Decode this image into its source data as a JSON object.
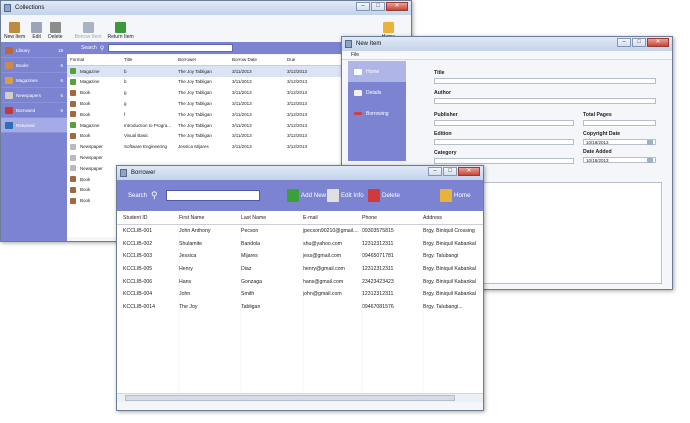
{
  "collections": {
    "title": "Collections",
    "toolbar": [
      {
        "label": "New Item",
        "icon": "new-item-icon",
        "color": "#c08a3e"
      },
      {
        "label": "Edit",
        "icon": "edit-icon",
        "color": "#9aa5b8"
      },
      {
        "label": "Delete",
        "icon": "delete-icon",
        "color": "#8c8c8c"
      },
      {
        "label": "Borrow Item",
        "icon": "borrow-icon",
        "color": "#a9b3c2"
      },
      {
        "label": "Return Item",
        "icon": "return-icon",
        "color": "#3a9a3a"
      }
    ],
    "home_label": "Home",
    "sidebar": [
      {
        "label": "Library",
        "count": "18",
        "color": "#b86b3a"
      },
      {
        "label": "Books",
        "count": "6",
        "color": "#c98b4a"
      },
      {
        "label": "Magazines",
        "count": "6",
        "color": "#d4a040"
      },
      {
        "label": "Newspapers",
        "count": "6",
        "color": "#cfcfcf"
      },
      {
        "label": "Borrowed",
        "count": "6",
        "color": "#c03a3a"
      },
      {
        "label": "Returned",
        "count": "",
        "color": "#2d6fb5"
      }
    ],
    "search_label": "Search",
    "columns": [
      "Format",
      "Title",
      "Borrower",
      "Borrow Date",
      "Due"
    ],
    "rows": [
      {
        "format": "Magazine",
        "title": "b",
        "borrower": "The Joy Tabligan",
        "borrow_date": "3/11/2013",
        "due": "3/12/2013",
        "icon": "#5aa03a"
      },
      {
        "format": "Magazine",
        "title": "b",
        "borrower": "The Joy Tabligan",
        "borrow_date": "3/11/2013",
        "due": "3/12/2013",
        "icon": "#5aa03a"
      },
      {
        "format": "Book",
        "title": "g",
        "borrower": "The Joy Tabligan",
        "borrow_date": "3/11/2013",
        "due": "3/12/2013",
        "icon": "#a5683a"
      },
      {
        "format": "Book",
        "title": "g",
        "borrower": "The Joy Tabligan",
        "borrow_date": "3/11/2013",
        "due": "3/12/2013",
        "icon": "#a5683a"
      },
      {
        "format": "Book",
        "title": "f",
        "borrower": "The Joy Tabligan",
        "borrow_date": "3/11/2013",
        "due": "3/12/2013",
        "icon": "#a5683a"
      },
      {
        "format": "Magazine",
        "title": "Introduction to Progra...",
        "borrower": "The Joy Tabligan",
        "borrow_date": "3/11/2013",
        "due": "3/12/2013",
        "icon": "#5aa03a"
      },
      {
        "format": "Book",
        "title": "Visual Basic",
        "borrower": "The Joy Tabligan",
        "borrow_date": "3/11/2013",
        "due": "3/12/2013",
        "icon": "#a5683a"
      },
      {
        "format": "Newspaper",
        "title": "Software Engineering",
        "borrower": "Jessica Mijares",
        "borrow_date": "3/11/2013",
        "due": "3/12/2013",
        "icon": "#b9b9c4"
      },
      {
        "format": "Newspaper",
        "title": "",
        "borrower": "",
        "borrow_date": "",
        "due": "",
        "icon": "#b9b9c4"
      },
      {
        "format": "Newspaper",
        "title": "",
        "borrower": "",
        "borrow_date": "",
        "due": "",
        "icon": "#b9b9c4"
      },
      {
        "format": "Book",
        "title": "",
        "borrower": "",
        "borrow_date": "",
        "due": "",
        "icon": "#a5683a"
      },
      {
        "format": "Book",
        "title": "",
        "borrower": "",
        "borrow_date": "",
        "due": "",
        "icon": "#a5683a"
      },
      {
        "format": "Book",
        "title": "",
        "borrower": "",
        "borrow_date": "",
        "due": "",
        "icon": "#a5683a"
      }
    ]
  },
  "new_item": {
    "title": "New Item",
    "menu": "File",
    "tabs": [
      {
        "label": "Home",
        "icon": "#ffffff"
      },
      {
        "label": "Details",
        "icon": "#f0f0f0"
      },
      {
        "label": "Borrowing",
        "icon": "#d04040"
      }
    ],
    "fields": {
      "title_label": "Title",
      "author_label": "Author",
      "publisher_label": "Publisher",
      "total_pages_label": "Total Pages",
      "edition_label": "Edition",
      "copyright_label": "Copyright Date",
      "copyright_value": "10/18/2013",
      "category_label": "Category",
      "date_added_label": "Date Added",
      "date_added_value": "10/18/2013"
    }
  },
  "borrower": {
    "title": "Borrower",
    "search_label": "Search",
    "actions": [
      {
        "label": "Add New",
        "icon": "#3aa03a"
      },
      {
        "label": "Edit Info",
        "icon": "#e0e0e0"
      },
      {
        "label": "Delete",
        "icon": "#d03a3a"
      }
    ],
    "home_label": "Home",
    "columns": [
      "Student ID",
      "First Name",
      "Last Name",
      "E-mail",
      "Phone",
      "Address"
    ],
    "rows": [
      [
        "KCCLIB-001",
        "John Anthony",
        "Pecson",
        "jpecson90210@gmail....",
        "09303575815",
        "Brgy. Biniquil Crossing"
      ],
      [
        "KCCLIB-002",
        "Shulamite",
        "Bandola",
        "shu@yahoo.com",
        "12312312311",
        "Brgy. Biniquil Kabankal"
      ],
      [
        "KCCLIB-003",
        "Jessica",
        "Mijares",
        "jess@gmail.com",
        "09465071781",
        "Brgy. Talubangi"
      ],
      [
        "KCCLIB-005",
        "Henry",
        "Diaz",
        "henry@gmail.com",
        "12312312311",
        "Brgy. Biniquil Kabankal"
      ],
      [
        "KCCLIB-006",
        "Hans",
        "Gonzaga",
        "hans@gmail.com",
        "23423423423",
        "Brgy. Biniquil Kabankal"
      ],
      [
        "KCCLIB-004",
        "John",
        "Smith",
        "john@gmail.com",
        "12312312311",
        "Brgy. Biniquil Kabankal"
      ],
      [
        "KCCLIB-0014",
        "The Joy",
        "Tabligan",
        "",
        "09467081576",
        "Brgy. Talubangi..."
      ]
    ]
  }
}
